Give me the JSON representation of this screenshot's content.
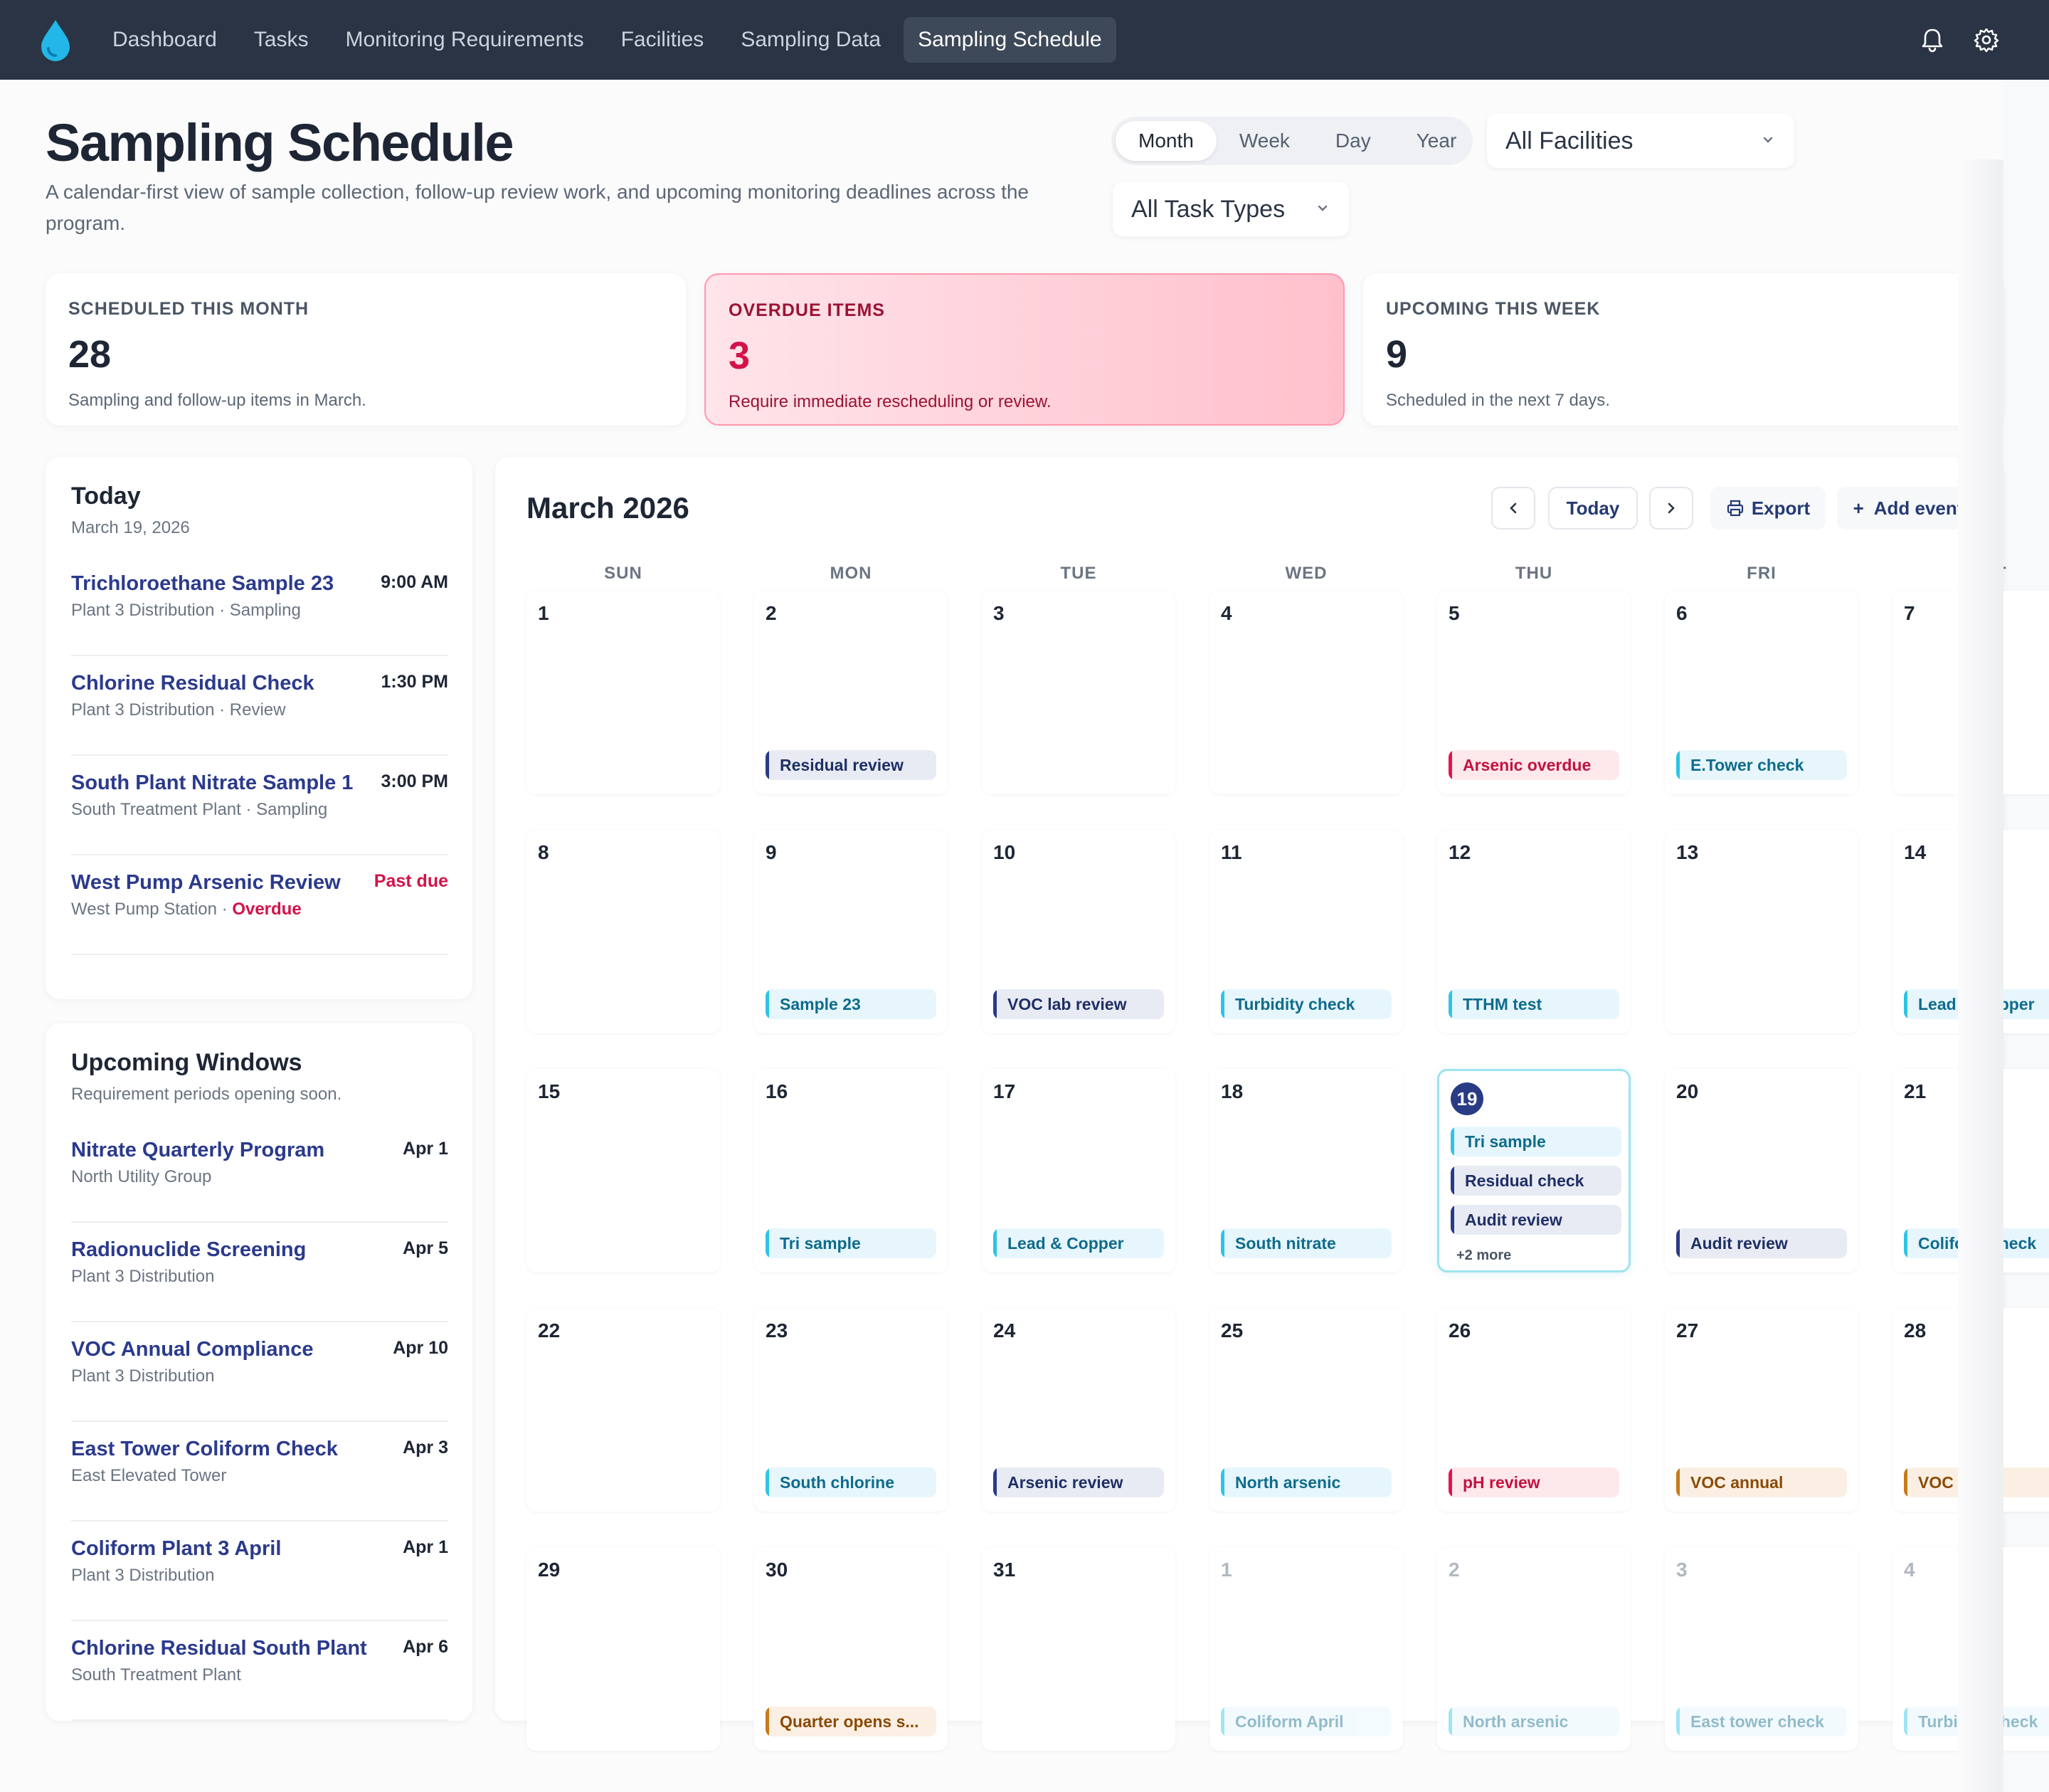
{
  "nav": {
    "items": [
      "Dashboard",
      "Tasks",
      "Monitoring Requirements",
      "Facilities",
      "Sampling Data",
      "Sampling Schedule"
    ],
    "active_index": 5,
    "icons": [
      "water-drop-icon",
      "bell-icon",
      "gear-icon"
    ]
  },
  "header": {
    "title": "Sampling Schedule",
    "subtitle": "A calendar-first view of sample collection, follow-up review work, and upcoming monitoring deadlines across the program."
  },
  "view_toggle": {
    "options": [
      "Month",
      "Week",
      "Day",
      "Year"
    ],
    "selected": "Month"
  },
  "filters": {
    "facility": "All Facilities",
    "task_type": "All Task Types"
  },
  "stats": [
    {
      "label": "SCHEDULED THIS MONTH",
      "value": "28",
      "desc": "Sampling and follow-up items in March."
    },
    {
      "label": "OVERDUE ITEMS",
      "value": "3",
      "desc": "Require immediate rescheduling or review."
    },
    {
      "label": "UPCOMING THIS WEEK",
      "value": "9",
      "desc": "Scheduled in the next 7 days."
    }
  ],
  "today_panel": {
    "title": "Today",
    "date": "March 19, 2026",
    "items": [
      {
        "title": "Trichloroethane Sample 23",
        "sub": "Plant 3 Distribution · Sampling",
        "time": "9:00 AM"
      },
      {
        "title": "Chlorine Residual Check",
        "sub": "Plant 3 Distribution · Review",
        "time": "1:30 PM"
      },
      {
        "title": "South Plant Nitrate Sample 1",
        "sub": "South Treatment Plant · Sampling",
        "time": "3:00 PM"
      },
      {
        "title": "West Pump Arsenic Review",
        "sub_location": "West Pump Station · ",
        "sub_status": "Overdue",
        "time": "Past due"
      }
    ]
  },
  "upcoming_panel": {
    "title": "Upcoming Windows",
    "subtitle": "Requirement periods opening soon.",
    "items": [
      {
        "title": "Nitrate Quarterly Program",
        "sub": "North Utility Group",
        "date": "Apr 1"
      },
      {
        "title": "Radionuclide Screening",
        "sub": "Plant 3 Distribution",
        "date": "Apr 5"
      },
      {
        "title": "VOC Annual Compliance",
        "sub": "Plant 3 Distribution",
        "date": "Apr 10"
      },
      {
        "title": "East Tower Coliform Check",
        "sub": "East Elevated Tower",
        "date": "Apr 3"
      },
      {
        "title": "Coliform Plant 3 April",
        "sub": "Plant 3 Distribution",
        "date": "Apr 1"
      },
      {
        "title": "Chlorine Residual South Plant",
        "sub": "South Treatment Plant",
        "date": "Apr 6"
      }
    ]
  },
  "calendar": {
    "title": "March 2026",
    "today_label": "Today",
    "export_label": "Export",
    "add_label": "Add event",
    "weekdays": [
      "SUN",
      "MON",
      "TUE",
      "WED",
      "THU",
      "FRI",
      "SAT"
    ],
    "weeks": [
      [
        {
          "num": "1",
          "events": []
        },
        {
          "num": "2",
          "events": [
            {
              "label": "Residual review",
              "kind": "navy"
            }
          ]
        },
        {
          "num": "3",
          "events": []
        },
        {
          "num": "4",
          "events": []
        },
        {
          "num": "5",
          "events": [
            {
              "label": "Arsenic overdue",
              "kind": "red"
            }
          ]
        },
        {
          "num": "6",
          "events": [
            {
              "label": "E.Tower check",
              "kind": "cyan"
            }
          ]
        },
        {
          "num": "7",
          "events": []
        }
      ],
      [
        {
          "num": "8",
          "events": []
        },
        {
          "num": "9",
          "events": [
            {
              "label": "Sample 23",
              "kind": "cyan"
            }
          ]
        },
        {
          "num": "10",
          "events": [
            {
              "label": "VOC lab review",
              "kind": "navy"
            }
          ]
        },
        {
          "num": "11",
          "events": [
            {
              "label": "Turbidity check",
              "kind": "cyan"
            }
          ]
        },
        {
          "num": "12",
          "events": [
            {
              "label": "TTHM test",
              "kind": "cyan"
            }
          ]
        },
        {
          "num": "13",
          "events": []
        },
        {
          "num": "14",
          "events": [
            {
              "label": "Lead & Copper",
              "kind": "cyan"
            }
          ]
        }
      ],
      [
        {
          "num": "15",
          "events": []
        },
        {
          "num": "16",
          "events": [
            {
              "label": "Tri sample",
              "kind": "cyan"
            }
          ]
        },
        {
          "num": "17",
          "events": [
            {
              "label": "Lead & Copper",
              "kind": "cyan"
            }
          ]
        },
        {
          "num": "18",
          "events": [
            {
              "label": "South nitrate",
              "kind": "cyan"
            }
          ]
        },
        {
          "num": "19",
          "today": true,
          "more": "+2 more",
          "events": [
            {
              "label": "Tri sample",
              "kind": "cyan"
            },
            {
              "label": "Residual check",
              "kind": "navy"
            },
            {
              "label": "Audit review",
              "kind": "navy"
            }
          ]
        },
        {
          "num": "20",
          "events": [
            {
              "label": "Audit review",
              "kind": "navy"
            }
          ]
        },
        {
          "num": "21",
          "events": [
            {
              "label": "Coliform check",
              "kind": "cyan"
            }
          ]
        }
      ],
      [
        {
          "num": "22",
          "events": []
        },
        {
          "num": "23",
          "events": [
            {
              "label": "South chlorine",
              "kind": "cyan"
            }
          ]
        },
        {
          "num": "24",
          "events": [
            {
              "label": "Arsenic review",
              "kind": "navy"
            }
          ]
        },
        {
          "num": "25",
          "events": [
            {
              "label": "North arsenic",
              "kind": "cyan"
            }
          ]
        },
        {
          "num": "26",
          "events": [
            {
              "label": "pH review",
              "kind": "red"
            }
          ]
        },
        {
          "num": "27",
          "events": [
            {
              "label": "VOC annual",
              "kind": "amber"
            }
          ]
        },
        {
          "num": "28",
          "events": [
            {
              "label": "VOC prep",
              "kind": "amber"
            }
          ]
        }
      ],
      [
        {
          "num": "29",
          "events": []
        },
        {
          "num": "30",
          "events": [
            {
              "label": "Quarter opens s...",
              "kind": "amber"
            }
          ]
        },
        {
          "num": "31",
          "events": []
        },
        {
          "num": "1",
          "muted": true,
          "events": [
            {
              "label": "Coliform April",
              "kind": "cyan"
            }
          ]
        },
        {
          "num": "2",
          "muted": true,
          "events": [
            {
              "label": "North arsenic",
              "kind": "cyan"
            }
          ]
        },
        {
          "num": "3",
          "muted": true,
          "events": [
            {
              "label": "East tower check",
              "kind": "cyan"
            }
          ]
        },
        {
          "num": "4",
          "muted": true,
          "events": [
            {
              "label": "Turbidity check",
              "kind": "cyan"
            }
          ]
        }
      ]
    ]
  }
}
